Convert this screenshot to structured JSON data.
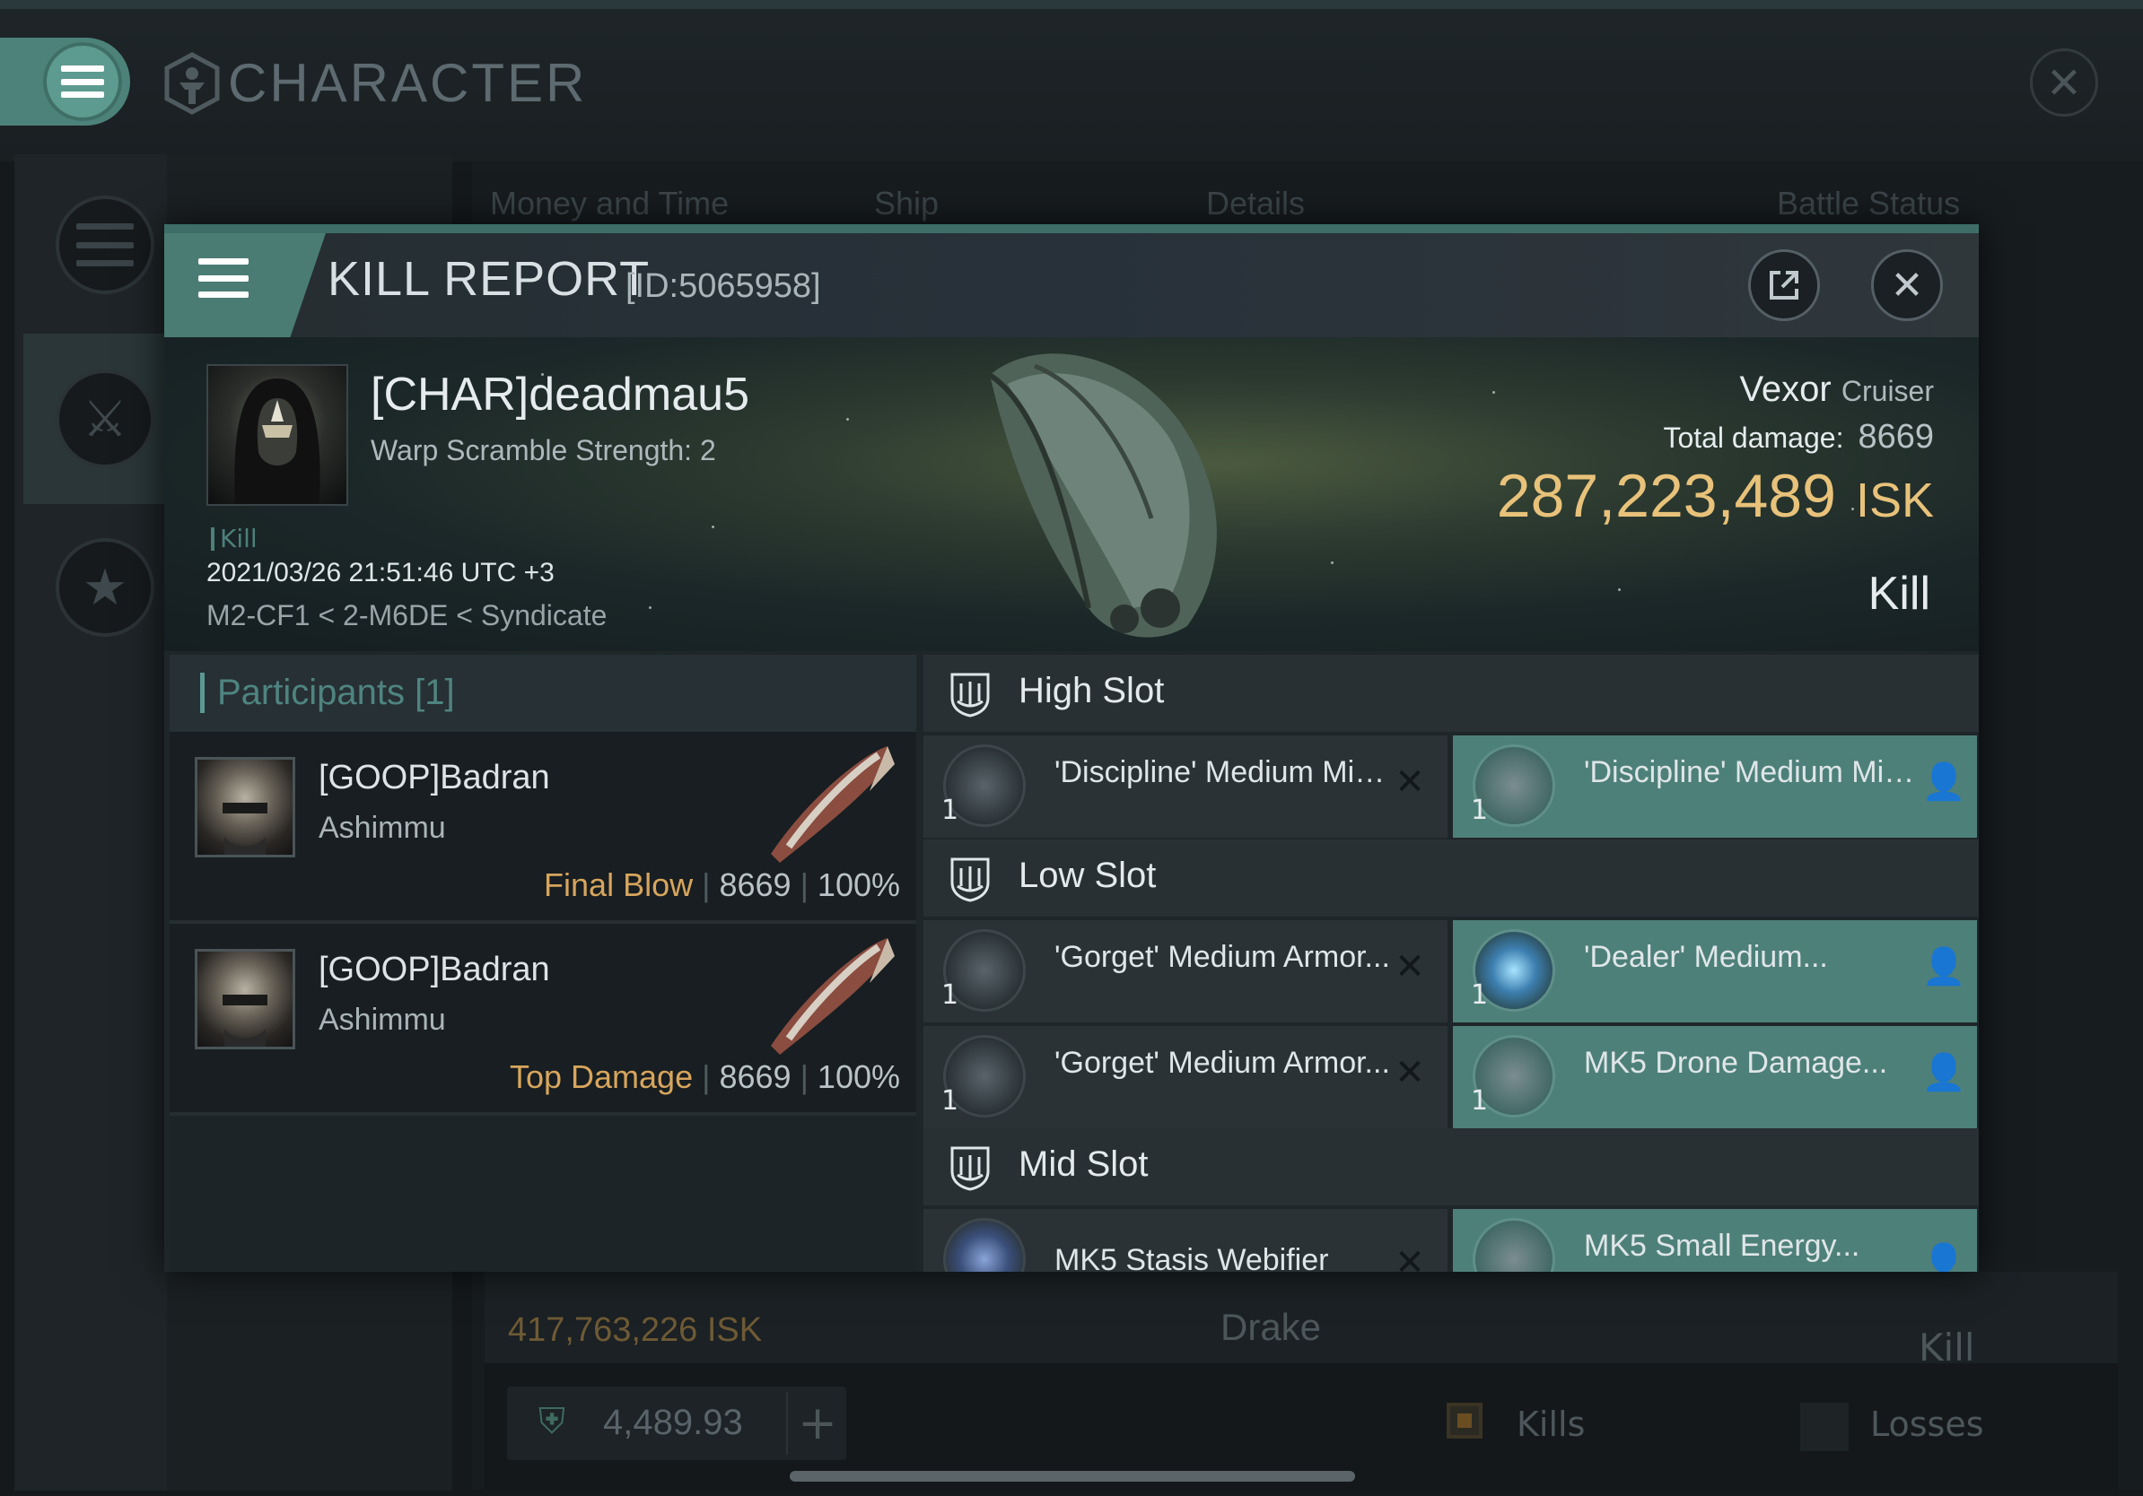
{
  "app": {
    "title": "CHARACTER"
  },
  "background": {
    "tabs": [
      "Money and Time",
      "Ship",
      "Details",
      "Battle Status"
    ],
    "row": {
      "isk": "417,763,226  ISK",
      "ship": "Drake",
      "result": "Kill"
    },
    "wallet": {
      "amount": "4,489.93",
      "plus": "+"
    },
    "filters": {
      "kills": "Kills",
      "losses": "Losses"
    }
  },
  "modal": {
    "title": "KILL REPORT",
    "id": "[ID:5065958]",
    "victim": {
      "name": "[CHAR]deadmau5",
      "subtitle": "Warp Scramble Strength: 2",
      "tag": "Kill",
      "datetime": "2021/03/26 21:51:46 UTC +3",
      "location": "M2-CF1 < 2-M6DE < Syndicate",
      "ship": "Vexor",
      "ship_class": "Cruiser",
      "total_damage_label": "Total damage:",
      "total_damage": "8669",
      "isk_value": "287,223,489",
      "isk_unit": "ISK",
      "result": "Kill"
    },
    "participants": {
      "title": "Participants [1]",
      "rows": [
        {
          "name": "[GOOP]Badran",
          "ship": "Ashimmu",
          "role": "Final Blow",
          "damage": "8669",
          "percent": "100%"
        },
        {
          "name": "[GOOP]Badran",
          "ship": "Ashimmu",
          "role": "Top Damage",
          "damage": "8669",
          "percent": "100%"
        }
      ]
    },
    "fitting": {
      "sections": [
        {
          "title": "High Slot",
          "modules": [
            {
              "qty": "1",
              "name": "'Discipline' Medium Missile...",
              "status": "destroyed",
              "icon": "missile-launcher-icon"
            },
            {
              "qty": "1",
              "name": "'Discipline' Medium Missile...",
              "status": "dropped",
              "icon": "missile-launcher-icon"
            }
          ]
        },
        {
          "title": "Low Slot",
          "modules": [
            {
              "qty": "1",
              "name": "'Gorget' Medium Armor...",
              "status": "destroyed",
              "icon": "armor-repairer-icon"
            },
            {
              "qty": "1",
              "name": "'Dealer' Medium...",
              "status": "dropped",
              "icon": "energized-plating-icon"
            },
            {
              "qty": "1",
              "name": "'Gorget' Medium Armor...",
              "status": "destroyed",
              "icon": "armor-repairer-icon"
            },
            {
              "qty": "1",
              "name": "MK5 Drone Damage...",
              "status": "dropped",
              "icon": "drone-damage-icon"
            }
          ]
        },
        {
          "title": "Mid Slot",
          "modules": [
            {
              "qty": "",
              "name": "MK5 Stasis Webifier",
              "status": "destroyed",
              "icon": "stasis-webifier-icon"
            },
            {
              "qty": "",
              "name": "MK5 Small Energy...",
              "status": "dropped",
              "icon": "energy-neutralizer-icon"
            }
          ]
        }
      ]
    }
  },
  "colors": {
    "accent": "#4e807a",
    "isk": "#e8c27a",
    "role": "#d7a55d"
  }
}
